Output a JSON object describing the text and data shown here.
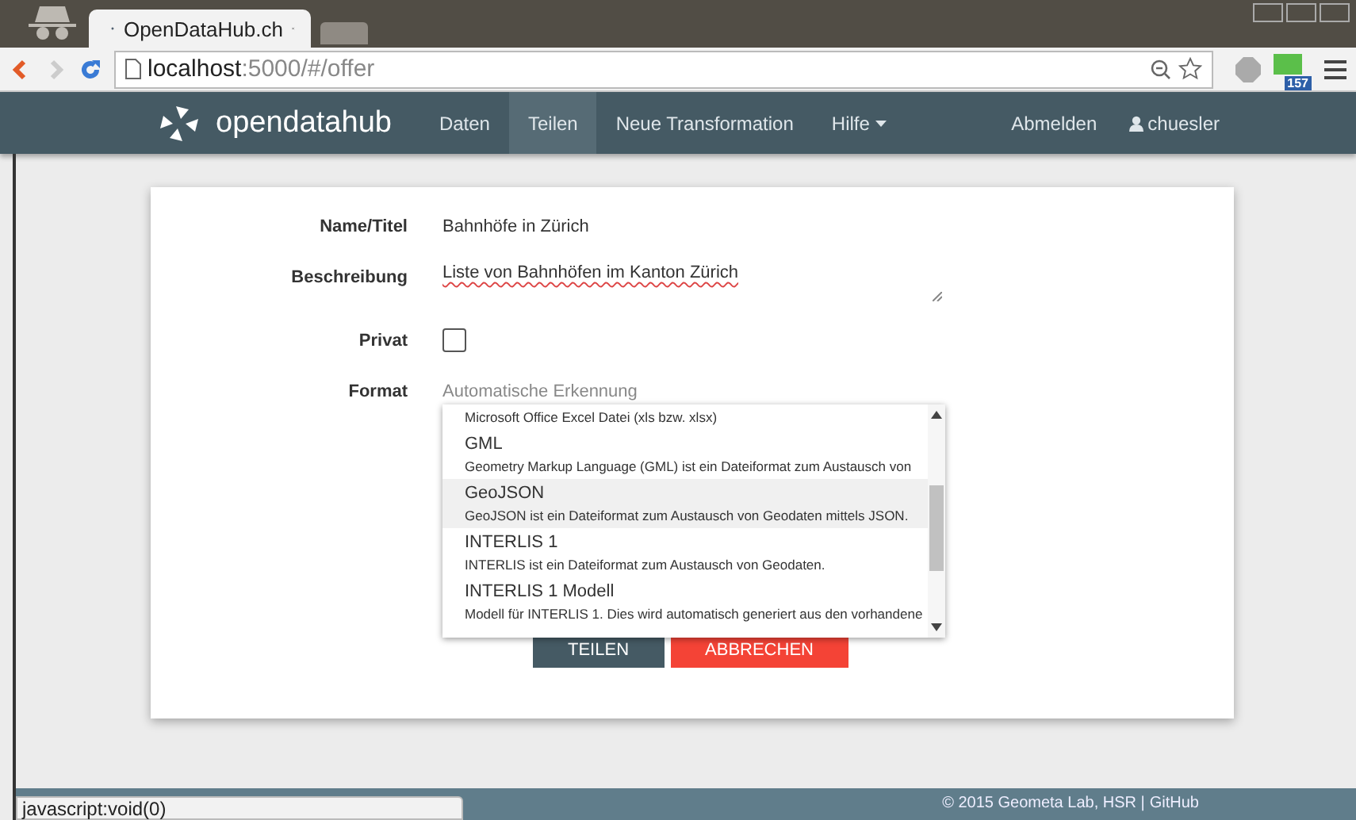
{
  "browser": {
    "tabs": [
      {
        "title": "OpenDataHub.ch",
        "selected": true
      }
    ],
    "address": {
      "host": "localhost",
      "path": ":5000/#/offer"
    },
    "extension_badge": "157",
    "status_text": "javascript:void(0)"
  },
  "navbar": {
    "brand": "opendatahub",
    "items": [
      {
        "label": "Daten",
        "selected": false,
        "has_menu": false
      },
      {
        "label": "Teilen",
        "selected": true,
        "has_menu": false
      },
      {
        "label": "Neue Transformation",
        "selected": false,
        "has_menu": false
      },
      {
        "label": "Hilfe",
        "selected": false,
        "has_menu": true
      }
    ],
    "logout": "Abmelden",
    "user": "chuesler"
  },
  "form": {
    "name_label": "Name/Titel",
    "name_value": "Bahnhöfe in Zürich",
    "description_label": "Beschreibung",
    "description_value": "Liste von Bahnhöfen im Kanton Zürich",
    "private_label": "Privat",
    "private_checked": false,
    "format_label": "Format",
    "format_placeholder": "Automatische Erkennung",
    "format_options": [
      {
        "description": "Microsoft Office Excel Datei (xls bzw. xlsx)",
        "selected": false
      },
      {
        "title": "GML",
        "description": "Geometry Markup Language (GML) ist ein Dateiformat zum Austausch von",
        "selected": false
      },
      {
        "title": "GeoJSON",
        "description": "GeoJSON ist ein Dateiformat zum Austausch von Geodaten mittels JSON.",
        "selected": true
      },
      {
        "title": "INTERLIS 1",
        "description": "INTERLIS ist ein Dateiformat zum Austausch von Geodaten.",
        "selected": false
      },
      {
        "title": "INTERLIS 1 Modell",
        "description": "Modell für INTERLIS 1. Dies wird automatisch generiert aus den vorhandene",
        "selected": false
      }
    ],
    "buttons": [
      {
        "label": "TEILEN",
        "kind": "primary"
      },
      {
        "label": "ABBRECHEN",
        "kind": "danger"
      }
    ]
  },
  "footer": {
    "text": "© 2015 Geometa Lab, HSR |",
    "link": "GitHub"
  }
}
